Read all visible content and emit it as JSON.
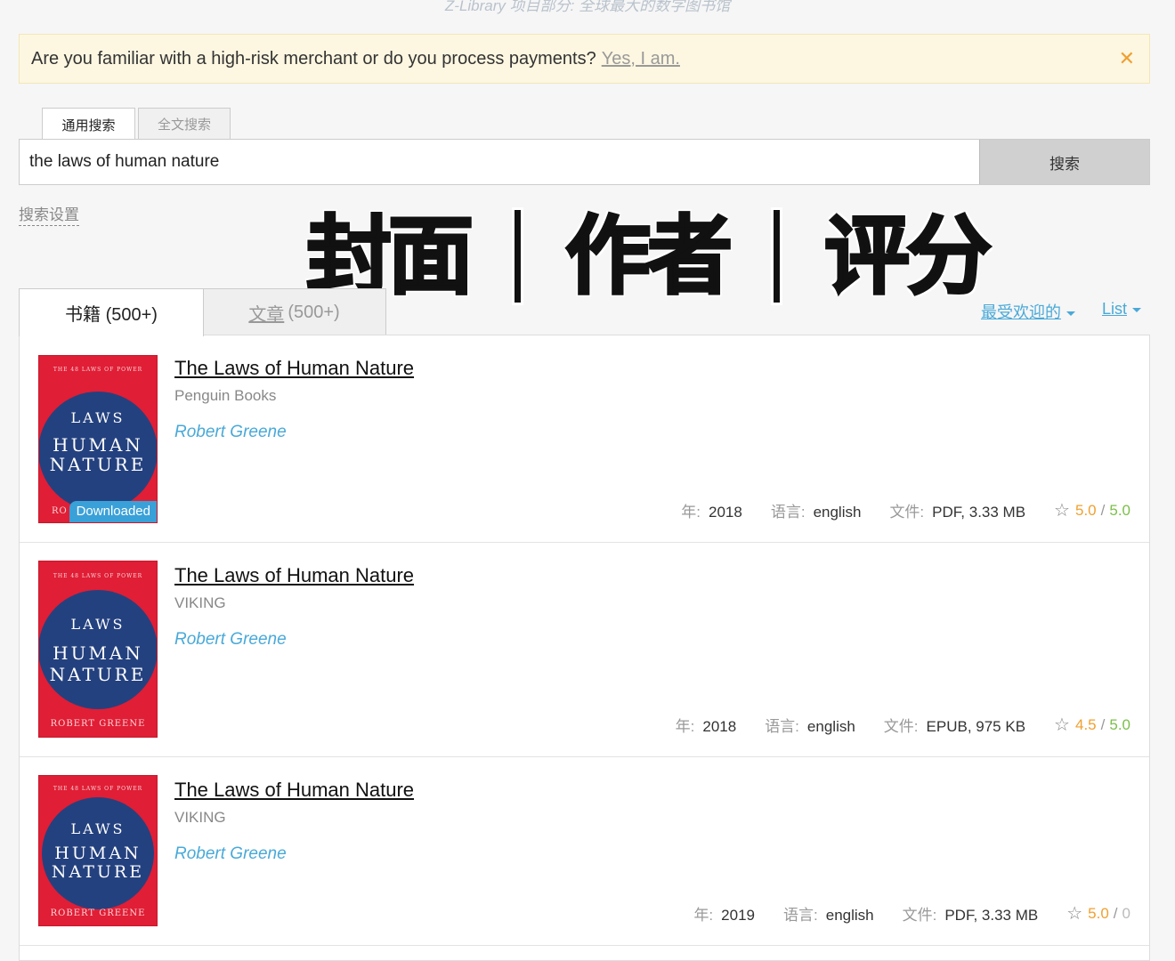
{
  "site_tagline": "Z-Library 项目部分: 全球最大的数字图书馆",
  "banner": {
    "text": "Are you familiar with a high-risk merchant or do you process payments?",
    "link": "Yes, I am.",
    "close_icon": "close-icon"
  },
  "search": {
    "tabs": [
      "通用搜索",
      "全文搜索"
    ],
    "query": "the laws of human nature",
    "button": "搜索",
    "settings": "搜索设置"
  },
  "overlay_text": [
    "封面",
    "作者",
    "评分"
  ],
  "result_tabs": {
    "books": "书籍 (500+)",
    "articles_link": "文章",
    "articles_count": "(500+)"
  },
  "sort": {
    "popular": "最受欢迎的",
    "view": "List"
  },
  "labels": {
    "year": "年:",
    "language": "语言:",
    "file": "文件:"
  },
  "results": [
    {
      "title": "The Laws of Human Nature",
      "publisher": "Penguin Books",
      "author": "Robert Greene",
      "year": "2018",
      "language": "english",
      "file": "PDF, 3.33 MB",
      "rating": "5.0",
      "quality": "5.0",
      "downloaded": "Downloaded",
      "cover": {
        "top": "THE 48 LAWS OF POWER",
        "line1": "LAWS",
        "line2": "HUMAN",
        "line3": "NATURE",
        "bottom": "RO"
      }
    },
    {
      "title": "The Laws of Human Nature",
      "publisher": "VIKING",
      "author": "Robert Greene",
      "year": "2018",
      "language": "english",
      "file": "EPUB, 975 KB",
      "rating": "4.5",
      "quality": "5.0",
      "cover": {
        "top": "THE 48 LAWS OF POWER",
        "line1": "LAWS",
        "line2": "HUMAN",
        "line3": "NATURE",
        "bottom": "ROBERT GREENE"
      }
    },
    {
      "title": "The Laws of Human Nature",
      "publisher": "VIKING",
      "author": "Robert Greene",
      "year": "2019",
      "language": "english",
      "file": "PDF, 3.33 MB",
      "rating": "5.0",
      "quality": "0",
      "cover": {
        "top": "THE 48 LAWS OF POWER",
        "line1": "LAWS",
        "line2": "HUMAN",
        "line3": "NATURE",
        "bottom": "ROBERT GREENE"
      }
    }
  ],
  "colors": {
    "link": "#49a9d8",
    "rating": "#f0a030",
    "quality": "#7bbf4a",
    "cover_red": "#e01e35",
    "cover_blue": "#24417f"
  }
}
